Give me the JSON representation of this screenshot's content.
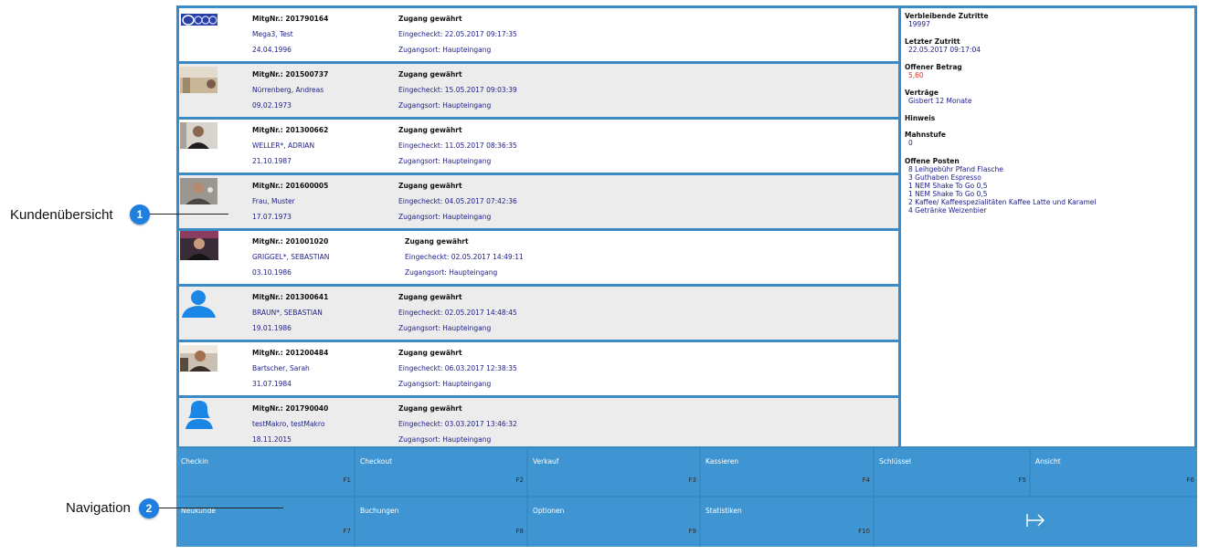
{
  "members": [
    {
      "nr": "MitgNr.: 201790164",
      "name": "Mega3, Test",
      "dob": "24.04.1996",
      "status": "Zugang gewährt",
      "checkin": "Eingecheckt: 22.05.2017 09:17:35",
      "place": "Zugangsort: Haupteingang",
      "photo": "logo-image"
    },
    {
      "nr": "MitgNr.: 201500737",
      "name": "Nürrenberg, Andreas",
      "dob": "09.02.1973",
      "status": "Zugang gewährt",
      "checkin": "Eingecheckt: 15.05.2017 09:03:39",
      "place": "Zugangsort: Haupteingang",
      "photo": "member-photo"
    },
    {
      "nr": "MitgNr.: 201300662",
      "name": "WELLER*, ADRIAN",
      "dob": "21.10.1987",
      "status": "Zugang gewährt",
      "checkin": "Eingecheckt: 11.05.2017 08:36:35",
      "place": "Zugangsort: Haupteingang",
      "photo": "member-photo"
    },
    {
      "nr": "MitgNr.: 201600005",
      "name": "Frau, Muster",
      "dob": "17.07.1973",
      "status": "Zugang gewährt",
      "checkin": "Eingecheckt: 04.05.2017 07:42:36",
      "place": "Zugangsort: Haupteingang",
      "photo": "member-photo"
    },
    {
      "nr": "MitgNr.: 201001020",
      "name": "GRIGGEL*, SEBASTIAN",
      "dob": "03.10.1986",
      "status": "Zugang gewährt",
      "checkin": "Eingecheckt: 02.05.2017 14:49:11",
      "place": "Zugangsort: Haupteingang",
      "photo": "member-photo"
    },
    {
      "nr": "MitgNr.: 201300641",
      "name": "BRAUN*, SEBASTIAN",
      "dob": "19.01.1986",
      "status": "Zugang gewährt",
      "checkin": "Eingecheckt: 02.05.2017 14:48:45",
      "place": "Zugangsort: Haupteingang",
      "photo": "male-avatar-icon"
    },
    {
      "nr": "MitgNr.: 201200484",
      "name": "Bartscher, Sarah",
      "dob": "31.07.1984",
      "status": "Zugang gewährt",
      "checkin": "Eingecheckt: 06.03.2017 12:38:35",
      "place": "Zugangsort: Haupteingang",
      "photo": "member-photo"
    },
    {
      "nr": "MitgNr.: 201790040",
      "name": "testMakro, testMakro",
      "dob": "18.11.2015",
      "status": "Zugang gewährt",
      "checkin": "Eingecheckt: 03.03.2017 13:46:32",
      "place": "Zugangsort: Haupteingang",
      "photo": "female-avatar-icon"
    }
  ],
  "details": {
    "remaining_label": "Verbleibende Zutritte",
    "remaining_value": "19997",
    "last_label": "Letzter Zutritt",
    "last_value": "22.05.2017 09:17:04",
    "open_label": "Offener Betrag",
    "open_value": "5,60",
    "contracts_label": "Verträge",
    "contracts_value": "Gisbert 12 Monate",
    "note_label": "Hinweis",
    "dunning_label": "Mahnstufe",
    "dunning_value": "0",
    "items_label": "Offene Posten",
    "items": [
      "8 Leihgebühr Pfand Flasche",
      "3 Guthaben Espresso",
      "1 NEM Shake To Go 0,5",
      "1 NEM Shake To Go 0,5",
      "2 Kaffee/ Kaffeespezialitäten Kaffee Latte und Karamel",
      "4 Getränke Weizenbier"
    ]
  },
  "nav": [
    {
      "label": "Checkin",
      "key": "F1"
    },
    {
      "label": "Checkout",
      "key": "F2"
    },
    {
      "label": "Verkauf",
      "key": "F3"
    },
    {
      "label": "Kassieren",
      "key": "F4"
    },
    {
      "label": "Schlüssel",
      "key": "F5"
    },
    {
      "label": "Ansicht",
      "key": "F6"
    },
    {
      "label": "Neukunde",
      "key": "F7"
    },
    {
      "label": "Buchungen",
      "key": "F8"
    },
    {
      "label": "Optionen",
      "key": "F9"
    },
    {
      "label": "Statistiken",
      "key": "F10"
    }
  ],
  "exit_icon": "exit-arrow-icon",
  "callouts": [
    {
      "text": "Kundenübersicht",
      "number": "1"
    },
    {
      "text": "Navigation",
      "number": "2"
    }
  ],
  "colors": {
    "accent": "#3a8ac6",
    "button": "#3e95d2",
    "badge": "#1e7fe0",
    "value_text": "#20208a",
    "amount": "#d93025"
  }
}
